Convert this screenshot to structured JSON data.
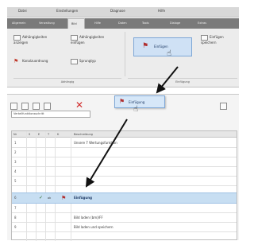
{
  "menubar": {
    "items": [
      "Datei",
      "Einstellungen",
      "Diagnose",
      "Hilfe"
    ]
  },
  "ribbon_tabs": {
    "items": [
      "Allgemein",
      "Verwaltung",
      "Bild",
      "Hilfe",
      "Daten",
      "Tools",
      "Dialoge",
      "Extras"
    ],
    "active_index": 2
  },
  "ribbon": {
    "buttons": [
      {
        "label": "Abhängigkeiten anzeigen",
        "icon": "dependency-icon"
      },
      {
        "label": "Abhängigkeiten einfügen",
        "icon": "insert-dependency-icon"
      },
      {
        "label": "Einfügen",
        "icon": "insert-icon"
      },
      {
        "label": "Einfügen speichern",
        "icon": "insert-save-icon"
      },
      {
        "label": "Kanalzuordnung",
        "icon": "channel-icon"
      },
      {
        "label": "Sprungtyp",
        "icon": "jump-icon"
      }
    ],
    "groups": [
      "Abhängig",
      "Einfügung"
    ]
  },
  "drag_item": {
    "label": "Einfügung",
    "icon": "insert-icon"
  },
  "panel": {
    "field_value": "Verteilfunktionsschritt",
    "columns": [
      "Nr",
      "S",
      "E",
      "T",
      "K",
      "Beschreibung"
    ],
    "rows": [
      {
        "n": "1",
        "text": "Unsere 7 Wertungsfunktion"
      },
      {
        "n": "2",
        "text": ""
      },
      {
        "n": "3",
        "text": ""
      },
      {
        "n": "4",
        "text": ""
      },
      {
        "n": "5",
        "text": ""
      },
      {
        "n": "6",
        "text": "Einfügung",
        "mark": "ok"
      },
      {
        "n": "7",
        "text": ""
      },
      {
        "n": "8",
        "text": "Bild laden (bm)/FF"
      },
      {
        "n": "9",
        "text": "Bild laden und speichern"
      }
    ]
  },
  "colors": {
    "selection": "#c7def2",
    "accent": "#7ea7d6",
    "delete_red": "#d12c2c"
  }
}
